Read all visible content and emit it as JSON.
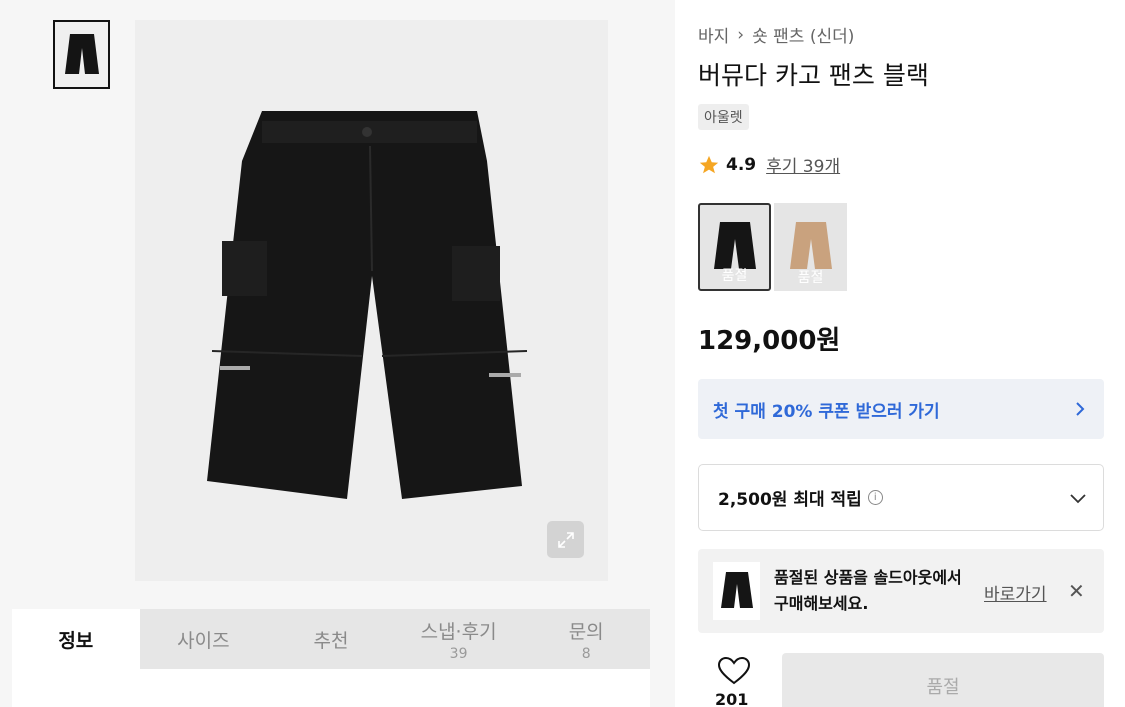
{
  "gallery": {
    "tabs": [
      {
        "label": "정보",
        "count": ""
      },
      {
        "label": "사이즈",
        "count": ""
      },
      {
        "label": "추천",
        "count": ""
      },
      {
        "label": "스냅·후기",
        "count": "39"
      },
      {
        "label": "문의",
        "count": "8"
      }
    ],
    "zoom_icon": "expand-icon"
  },
  "product": {
    "breadcrumb": [
      "바지",
      "숏 팬츠 (신더)"
    ],
    "title": "버뮤다 카고 팬츠 블랙",
    "tag": "아울렛",
    "rating": "4.9",
    "reviews": "후기 39개",
    "swatches": [
      {
        "label": "품절",
        "color": "#1a1a1a"
      },
      {
        "label": "품절",
        "color": "#c9a27e"
      }
    ],
    "price": "129,000원",
    "coupon": "첫 구매 20% 쿠폰 받으러 가기",
    "points": "2,500원 최대 적립",
    "soldout_msg": "품절된 상품을 솔드아웃에서 구매해보세요.",
    "soldout_link": "바로가기",
    "likes": "201",
    "buy_label": "품절"
  },
  "colors": {
    "accent_blue": "#2f69d8",
    "star": "#f5a623"
  }
}
